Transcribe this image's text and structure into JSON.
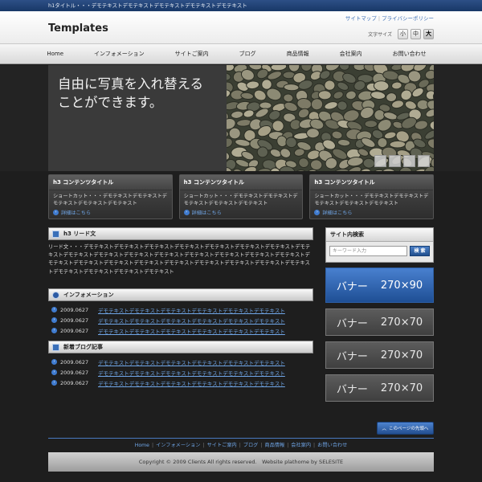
{
  "topbar": {
    "text": "h1タイトル・・・デモテキストデモテキストデモテキストデモテキストデモテキスト"
  },
  "header": {
    "logo": "Templates",
    "links": [
      "サイトマップ",
      "プライバシーポリシー"
    ],
    "font_size_label": "文字サイズ",
    "font_sizes": [
      "小",
      "中",
      "大"
    ]
  },
  "nav": [
    "Home",
    "インフォメーション",
    "サイトご案内",
    "ブログ",
    "商品情報",
    "会社案内",
    "お問い合わせ"
  ],
  "hero": {
    "line1": "自由に写真を入れ替える",
    "line2": "ことができます。"
  },
  "features": [
    {
      "title": "h3 コンテンツタイトル",
      "body": "ショートカット・・・デモテキストデモテキストデモテキストデモテキストデモテキスト",
      "more": "詳細はこちら"
    },
    {
      "title": "h3 コンテンツタイトル",
      "body": "ショートカット・・・デモテキストデモテキストデモテキストデモテキストデモテキスト",
      "more": "詳細はこちら"
    },
    {
      "title": "h3 コンテンツタイトル",
      "body": "ショートカット・・・デモテキストデモテキストデモテキストデモテキストデモテキスト",
      "more": "詳細はこちら"
    }
  ],
  "lead": {
    "title": "h3 リード文",
    "body": "リード文・・・デモテキストデモテキストデモテキストデモテキストデモテキストデモテキストデモテキストデモテキストデモテキストデモテキストデモテキストデモテキストデモテキストデモテキストデモテキストデモテキストデモテキストデモテキストデモテキストデモテキストデモテキストデモテキストデモテキストデモテキストデモテキストデモテキストデモテキストデモテキストデモテキスト"
  },
  "info": {
    "title": "インフォメーション",
    "items": [
      {
        "date": "2009.0627",
        "text": "デモテキストデモテキストデモテキストデモテキストデモテキストデモテキスト"
      },
      {
        "date": "2009.0627",
        "text": "デモテキストデモテキストデモテキストデモテキストデモテキストデモテキスト"
      },
      {
        "date": "2009.0627",
        "text": "デモテキストデモテキストデモテキストデモテキストデモテキストデモテキスト"
      }
    ]
  },
  "blog": {
    "title": "新着ブログ記事",
    "items": [
      {
        "date": "2009.0627",
        "text": "デモテキストデモテキストデモテキストデモテキストデモテキストデモテキスト"
      },
      {
        "date": "2009.0627",
        "text": "デモテキストデモテキストデモテキストデモテキストデモテキストデモテキスト"
      },
      {
        "date": "2009.0627",
        "text": "デモテキストデモテキストデモテキストデモテキストデモテキストデモテキスト"
      }
    ]
  },
  "sidebar": {
    "search_title": "サイト内検索",
    "search_placeholder": "キーワード入力",
    "search_button": "検 索",
    "banners": [
      {
        "label": "バナー",
        "size": "270×90"
      },
      {
        "label": "バナー",
        "size": "270×70"
      },
      {
        "label": "バナー",
        "size": "270×70"
      },
      {
        "label": "バナー",
        "size": "270×70"
      }
    ]
  },
  "page_top": "このページの先頭へ",
  "footer": {
    "links": [
      "Home",
      "インフォメーション",
      "サイトご案内",
      "ブログ",
      "商品情報",
      "会社案内",
      "お問い合わせ"
    ],
    "copyright": "Copyright © 2009 Clients All rights reserved.　Website plathome by SELESITE"
  },
  "colors": {
    "accent": "#3a6fb8",
    "link": "#6fa5e6",
    "bg": "#1e1e1e"
  }
}
